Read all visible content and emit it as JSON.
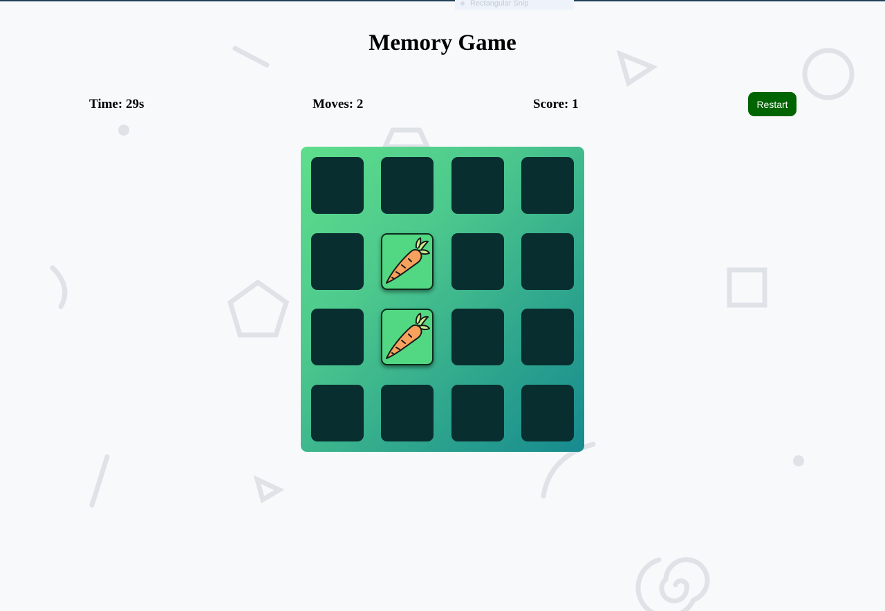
{
  "ghost_tab": {
    "label": "Rectangular Snip"
  },
  "header": {
    "title": "Memory Game"
  },
  "stats": {
    "time": "Time: 29s",
    "moves": "Moves: 2",
    "score": "Score: 1"
  },
  "controls": {
    "restart_label": "Restart"
  },
  "colors": {
    "card_back": "#082e2f",
    "card_face": "#52d882",
    "restart": "#006400",
    "board_gradient_start": "#5ede8c",
    "board_gradient_end": "#178a8f"
  },
  "board": {
    "rows": 4,
    "cols": 4,
    "cards": [
      {
        "state": "hidden"
      },
      {
        "state": "hidden"
      },
      {
        "state": "hidden"
      },
      {
        "state": "hidden"
      },
      {
        "state": "hidden"
      },
      {
        "state": "flipped",
        "icon": "carrot-icon"
      },
      {
        "state": "hidden"
      },
      {
        "state": "hidden"
      },
      {
        "state": "hidden"
      },
      {
        "state": "flipped",
        "icon": "carrot-icon"
      },
      {
        "state": "hidden"
      },
      {
        "state": "hidden"
      },
      {
        "state": "hidden"
      },
      {
        "state": "hidden"
      },
      {
        "state": "hidden"
      },
      {
        "state": "hidden"
      }
    ]
  }
}
